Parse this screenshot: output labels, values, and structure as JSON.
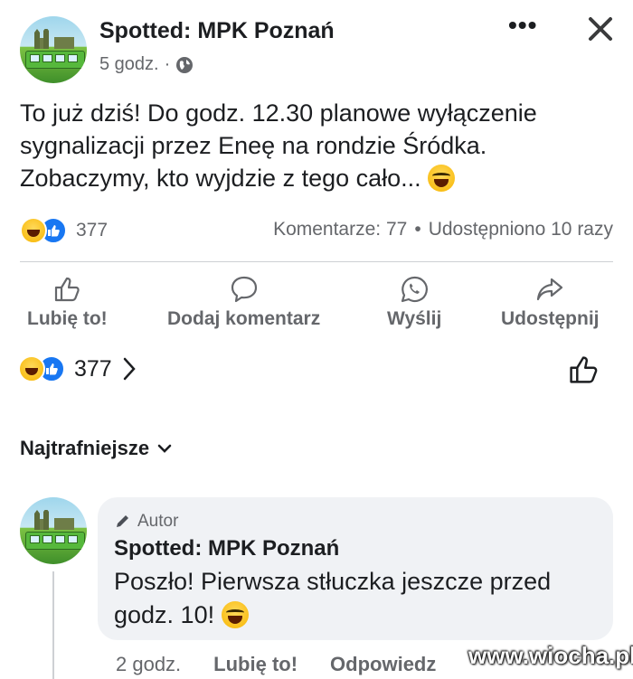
{
  "post": {
    "page_name": "Spotted: MPK Poznań",
    "time": "5 godz.",
    "separator": "·",
    "more_icon": "more-dots-icon",
    "close_icon": "close-icon",
    "text_lines": [
      "To już dziś! Do godz. 12.30 planowe wyłączenie",
      "sygnalizacji przez Eneę na rondzie Śródka.",
      "Zobaczymy, kto wyjdzie z tego cało..."
    ],
    "reaction_count": "377",
    "comments_label": "Komentarze: 77",
    "shares_label": "Udostępniono 10 razy"
  },
  "actions": {
    "like": "Lubię to!",
    "comment": "Dodaj komentarz",
    "send": "Wyślij",
    "share": "Udostępnij"
  },
  "reactions_bar": {
    "count": "377"
  },
  "comments_section": {
    "sort_label": "Najtrafniejsze"
  },
  "comment": {
    "badge": "Autor",
    "author": "Spotted: MPK Poznań",
    "text_lines": [
      "Poszło! Pierwsza stłuczka jeszcze przed",
      "godz. 10!"
    ],
    "time": "2 godz.",
    "like": "Lubię to!",
    "reply": "Odpowiedz"
  },
  "watermark": "www.wiocha.pl",
  "colors": {
    "accent": "#1877f2",
    "text": "#1c1e21",
    "secondary": "#65676b",
    "bubble": "#f0f2f5"
  }
}
